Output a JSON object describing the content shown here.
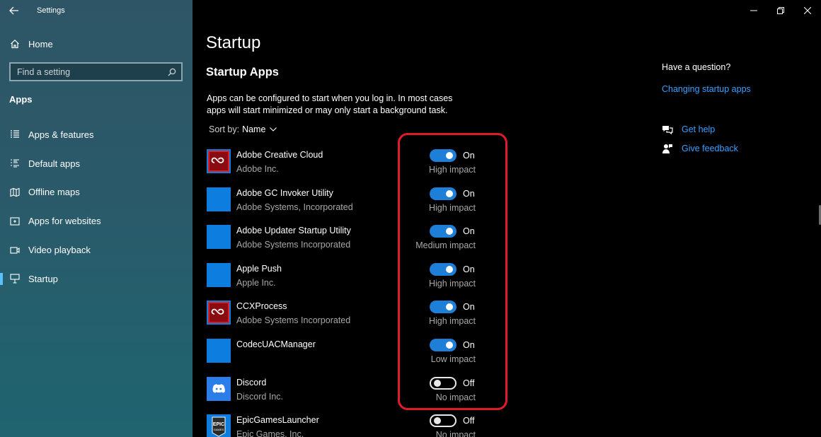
{
  "window": {
    "app_title": "Settings"
  },
  "sidebar": {
    "home_label": "Home",
    "search_placeholder": "Find a setting",
    "section_label": "Apps",
    "items": [
      {
        "label": "Apps & features",
        "icon": "list-icon"
      },
      {
        "label": "Default apps",
        "icon": "default-apps-icon"
      },
      {
        "label": "Offline maps",
        "icon": "map-icon"
      },
      {
        "label": "Apps for websites",
        "icon": "website-icon"
      },
      {
        "label": "Video playback",
        "icon": "video-icon"
      },
      {
        "label": "Startup",
        "icon": "startup-icon",
        "active": true
      }
    ]
  },
  "main": {
    "title": "Startup",
    "subtitle": "Startup Apps",
    "description": "Apps can be configured to start when you log in. In most cases apps will start minimized or may only start a background task.",
    "sort_label": "Sort by:",
    "sort_value": "Name",
    "apps": [
      {
        "name": "Adobe Creative Cloud",
        "publisher": "Adobe Inc.",
        "state": "On",
        "impact": "High impact",
        "icon": "adobe-cc-icon"
      },
      {
        "name": "Adobe GC Invoker Utility",
        "publisher": "Adobe Systems, Incorporated",
        "state": "On",
        "impact": "High impact",
        "icon": "app-icon"
      },
      {
        "name": "Adobe Updater Startup Utility",
        "publisher": "Adobe Systems Incorporated",
        "state": "On",
        "impact": "Medium impact",
        "icon": "app-icon"
      },
      {
        "name": "Apple Push",
        "publisher": "Apple Inc.",
        "state": "On",
        "impact": "High impact",
        "icon": "app-icon"
      },
      {
        "name": "CCXProcess",
        "publisher": "Adobe Systems Incorporated",
        "state": "On",
        "impact": "High impact",
        "icon": "adobe-cc-icon"
      },
      {
        "name": "CodecUACManager",
        "publisher": "",
        "state": "On",
        "impact": "Low impact",
        "icon": "app-icon"
      },
      {
        "name": "Discord",
        "publisher": "Discord Inc.",
        "state": "Off",
        "impact": "No impact",
        "icon": "discord-icon"
      },
      {
        "name": "EpicGamesLauncher",
        "publisher": "Epic Games, Inc.",
        "state": "Off",
        "impact": "No impact",
        "icon": "epic-games-icon"
      }
    ]
  },
  "help": {
    "question": "Have a question?",
    "startup_link": "Changing startup apps",
    "get_help": "Get help",
    "give_feedback": "Give feedback"
  },
  "colors": {
    "accent": "#1d7fd8",
    "link": "#3aa0ff",
    "highlight": "#e21b2b",
    "app_tile": "#0e7de0"
  }
}
